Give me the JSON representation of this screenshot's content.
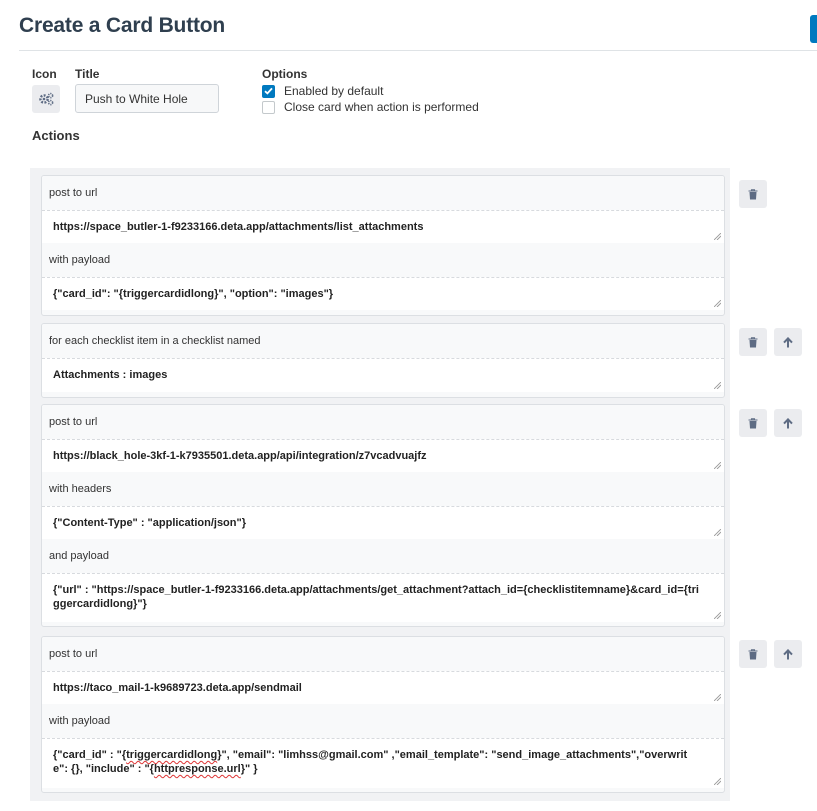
{
  "page": {
    "title": "Create a Card Button"
  },
  "form": {
    "icon_label": "Icon",
    "title_label": "Title",
    "title_value": "Push to White Hole",
    "options_label": "Options",
    "options": [
      {
        "label": "Enabled by default",
        "checked": true
      },
      {
        "label": "Close card when action is performed",
        "checked": false
      }
    ],
    "actions_label": "Actions"
  },
  "actions": [
    {
      "rows": [
        {
          "label": "post to url",
          "value": "https://space_butler-1-f9233166.deta.app/attachments/list_attachments"
        },
        {
          "label": "with payload",
          "value": "{\"card_id\": \"{triggercardidlong}\",  \"option\": \"images\"}"
        }
      ]
    },
    {
      "rows": [
        {
          "label": "for each checklist item in a checklist named",
          "value": "Attachments : images"
        }
      ]
    },
    {
      "rows": [
        {
          "label": "post to url",
          "value": "https://black_hole-3kf-1-k7935501.deta.app/api/integration/z7vcadvuajfz"
        },
        {
          "label": "with headers",
          "value": "{\"Content-Type\" : \"application/json\"}"
        },
        {
          "label": "and payload",
          "value": "{\"url\" : \"https://space_butler-1-f9233166.deta.app/attachments/get_attachment?attach_id={checklistitemname}&card_id={triggercardidlong}\"}"
        }
      ]
    },
    {
      "rows": [
        {
          "label": "post to url",
          "value": "https://taco_mail-1-k9689723.deta.app/sendmail"
        },
        {
          "label": "with payload",
          "value_parts": [
            "{\"card_id\" : \"{",
            "triggercardidlong",
            "}\", \"email\": \"limhss@gmail.com\" ,\"email_template\": \"send_image_attachments\",\"overwrite\": {}, \"include\" : \"{",
            "httpresponse.url",
            "}\" }"
          ]
        }
      ]
    }
  ],
  "icons": {
    "icon_picker": "gears-icon",
    "delete": "trash-icon",
    "move_up": "arrow-up-icon"
  },
  "colors": {
    "accent": "#0079bf",
    "title": "#2f3f4f"
  }
}
